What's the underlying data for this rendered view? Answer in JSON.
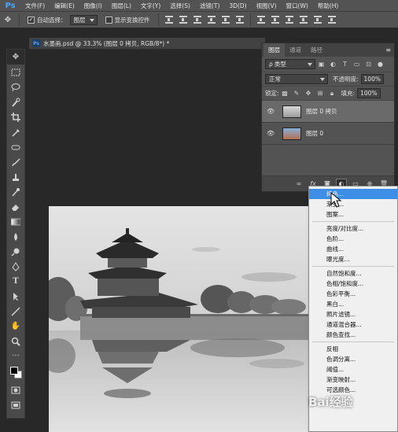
{
  "app": {
    "logo": "Ps"
  },
  "menubar": {
    "items": [
      "文件(F)",
      "编辑(E)",
      "图像(I)",
      "图层(L)",
      "文字(Y)",
      "选择(S)",
      "滤镜(T)",
      "3D(D)",
      "视图(V)",
      "窗口(W)",
      "帮助(H)"
    ]
  },
  "options": {
    "auto_select_label": "自动选择：",
    "auto_select_value": "图层",
    "show_transform_label": "显示变换控件"
  },
  "document": {
    "tab_title": "水墨画.psd @ 33.3% (图层 0 拷贝, RGB/8*) *"
  },
  "layers_panel": {
    "tabs": [
      "图层",
      "通道",
      "路径"
    ],
    "filter_kind": "类型",
    "blend_mode": "正常",
    "opacity_label": "不透明度:",
    "opacity_value": "100%",
    "lock_label": "锁定:",
    "fill_label": "填充:",
    "fill_value": "100%",
    "layers": [
      {
        "name": "图层 0 拷贝",
        "selected": true
      },
      {
        "name": "图层 0",
        "selected": false
      }
    ]
  },
  "adjustment_menu": {
    "group1": [
      "纯色...",
      "渐变...",
      "图案..."
    ],
    "group2": [
      "亮度/对比度...",
      "色阶...",
      "曲线...",
      "曝光度..."
    ],
    "group3": [
      "自然饱和度...",
      "色相/饱和度...",
      "色彩平衡...",
      "黑白...",
      "照片滤镜...",
      "通道混合器...",
      "颜色查找..."
    ],
    "group4": [
      "反相",
      "色调分离...",
      "阈值...",
      "渐变映射...",
      "可选颜色..."
    ],
    "highlighted": "纯色..."
  },
  "watermark": "Bai经验",
  "colors": {
    "accent": "#3d8ee6",
    "ps_blue": "#4aa5ff"
  }
}
